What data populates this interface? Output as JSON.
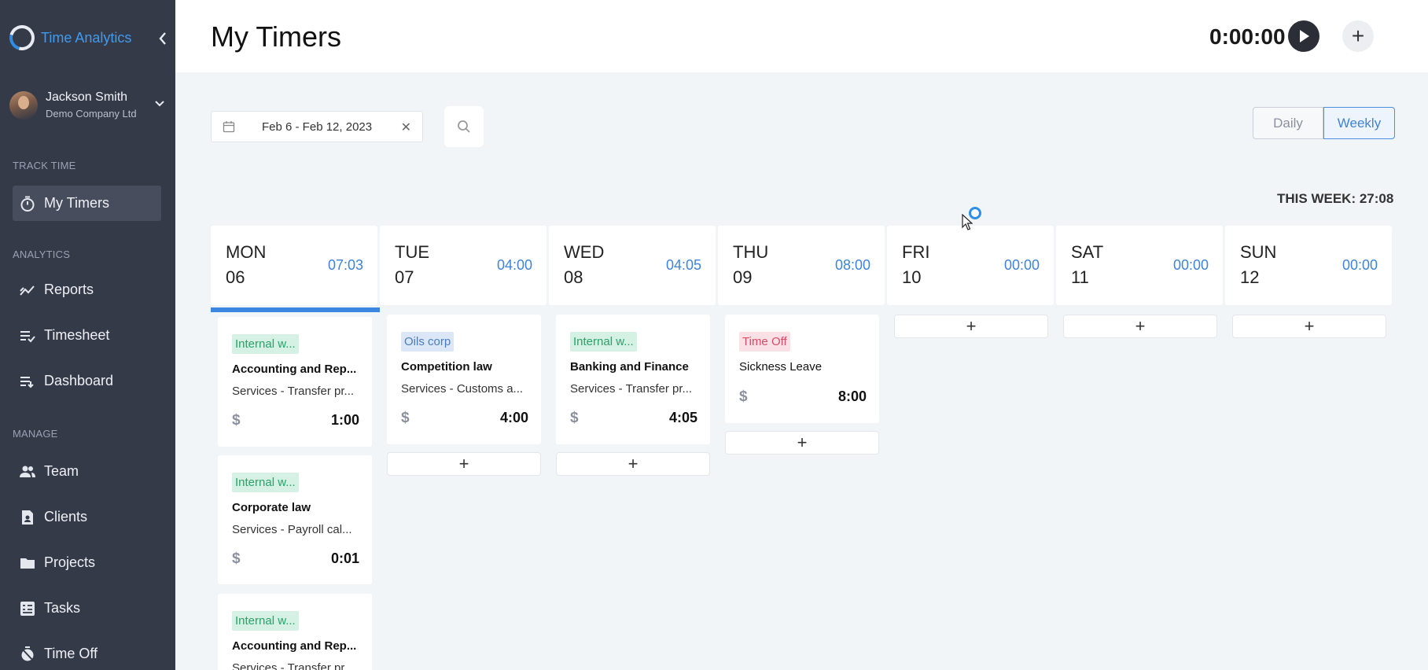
{
  "brand": {
    "name": "Time Analytics"
  },
  "user": {
    "name": "Jackson Smith",
    "company": "Demo Company Ltd"
  },
  "sidebar": {
    "sections": {
      "track": "TRACK TIME",
      "analytics": "ANALYTICS",
      "manage": "MANAGE"
    },
    "items": [
      {
        "label": "My Timers",
        "icon": "stopwatch-icon",
        "active": true
      },
      {
        "label": "Reports",
        "icon": "trend-chart-icon"
      },
      {
        "label": "Timesheet",
        "icon": "list-check-icon"
      },
      {
        "label": "Dashboard",
        "icon": "list-down-icon"
      },
      {
        "label": "Team",
        "icon": "people-icon"
      },
      {
        "label": "Clients",
        "icon": "contact-card-icon"
      },
      {
        "label": "Projects",
        "icon": "folder-icon"
      },
      {
        "label": "Tasks",
        "icon": "task-list-icon"
      },
      {
        "label": "Time Off",
        "icon": "timer-off-icon"
      }
    ]
  },
  "header": {
    "title": "My Timers",
    "timer": "0:00:00"
  },
  "toolbar": {
    "date_range": "Feb 6 - Feb 12, 2023",
    "view_daily": "Daily",
    "view_weekly": "Weekly",
    "selected_view": "Weekly"
  },
  "week_total": "THIS WEEK: 27:08",
  "accent_color": "#3a86e0",
  "days": [
    {
      "name": "MON",
      "num": "06",
      "total": "07:03",
      "selected": true
    },
    {
      "name": "TUE",
      "num": "07",
      "total": "04:00"
    },
    {
      "name": "WED",
      "num": "08",
      "total": "04:05"
    },
    {
      "name": "THU",
      "num": "09",
      "total": "08:00"
    },
    {
      "name": "FRI",
      "num": "10",
      "total": "00:00"
    },
    {
      "name": "SAT",
      "num": "11",
      "total": "00:00"
    },
    {
      "name": "SUN",
      "num": "12",
      "total": "00:00"
    }
  ],
  "entries": {
    "mon": [
      {
        "tag": "Internal w...",
        "title": "Accounting and Rep...",
        "sub": "Services - Transfer pr...",
        "billable": "$",
        "time": "1:00"
      },
      {
        "tag": "Internal w...",
        "title": "Corporate law",
        "sub": "Services - Payroll cal...",
        "billable": "$",
        "time": "0:01"
      },
      {
        "tag": "Internal w...",
        "title": "Accounting and Rep...",
        "sub": "Services - Transfer pr..."
      }
    ],
    "tue": [
      {
        "tag": "Oils corp",
        "title": "Competition law",
        "sub": "Services - Customs a...",
        "billable": "$",
        "time": "4:00"
      }
    ],
    "wed": [
      {
        "tag": "Internal w...",
        "title": "Banking and Finance",
        "sub": "Services - Transfer pr...",
        "billable": "$",
        "time": "4:05"
      }
    ],
    "thu": [
      {
        "tag": "Time Off",
        "title": "Sickness Leave",
        "billable": "$",
        "time": "8:00"
      }
    ]
  },
  "add_label": "+"
}
